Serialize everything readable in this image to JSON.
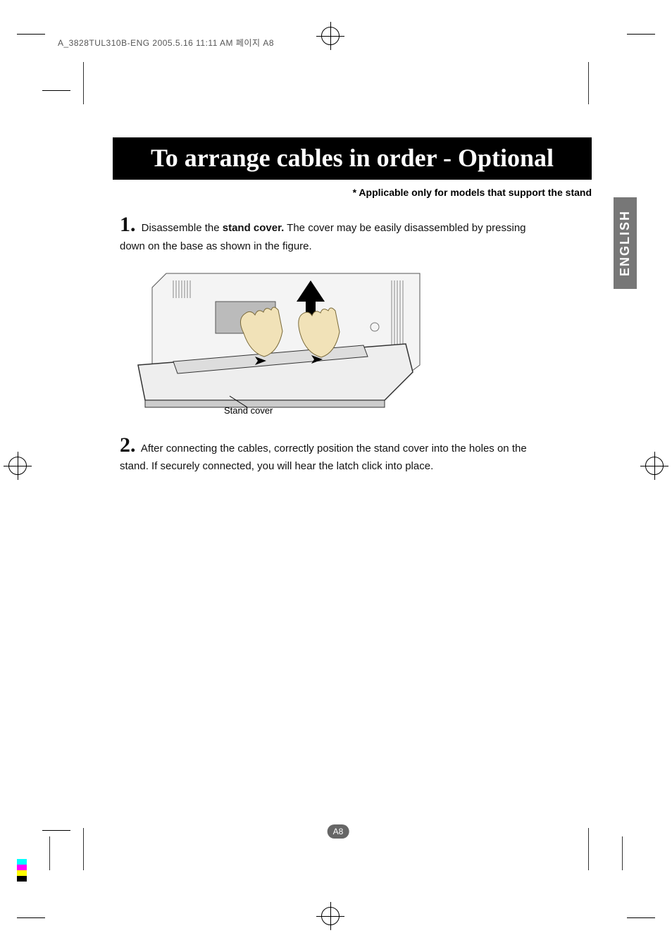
{
  "header_line": "A_3828TUL310B-ENG  2005.5.16  11:11 AM  페이지 A8",
  "title": "To arrange cables in order - Optional",
  "note": "* Applicable only for models that support the stand",
  "steps": {
    "s1": {
      "num": "1.",
      "pre": "Disassemble the ",
      "bold": "stand cover.",
      "post": " The cover may be easily disassembled by pressing down on the base as shown in the figure."
    },
    "s2": {
      "num": "2.",
      "text": "After connecting the cables, correctly position the stand cover into the holes on the stand. If securely connected, you will hear the latch click into place."
    }
  },
  "figure_caption": "Stand cover",
  "language_tab": "ENGLISH",
  "page_number": "A8"
}
